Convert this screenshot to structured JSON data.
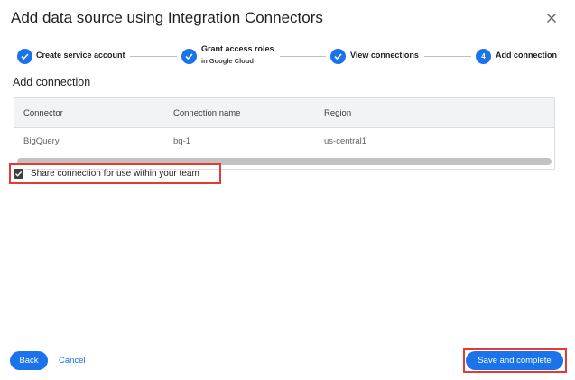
{
  "dialog": {
    "title": "Add data source using Integration Connectors"
  },
  "stepper": {
    "steps": [
      {
        "label": "Create service account",
        "sublabel": "",
        "state": "done"
      },
      {
        "label": "Grant access roles",
        "sublabel": "in Google Cloud",
        "state": "done"
      },
      {
        "label": "View connections",
        "sublabel": "",
        "state": "done"
      },
      {
        "label": "Add connection",
        "sublabel": "",
        "state": "current",
        "number": "4"
      }
    ]
  },
  "section": {
    "title": "Add connection"
  },
  "table": {
    "columns": [
      "Connector",
      "Connection name",
      "Region"
    ],
    "rows": [
      [
        "BigQuery",
        "bq-1",
        "us-central1"
      ]
    ]
  },
  "share": {
    "label": "Share connection for use within your team",
    "checked": true
  },
  "footer": {
    "back_label": "Back",
    "cancel_label": "Cancel",
    "save_label": "Save and complete"
  },
  "colors": {
    "primary": "#1a73e8",
    "highlight_box": "#e53935"
  },
  "icons": {
    "close": "close-icon",
    "step_done": "check-icon",
    "checkbox": "checkbox-checked-icon"
  }
}
